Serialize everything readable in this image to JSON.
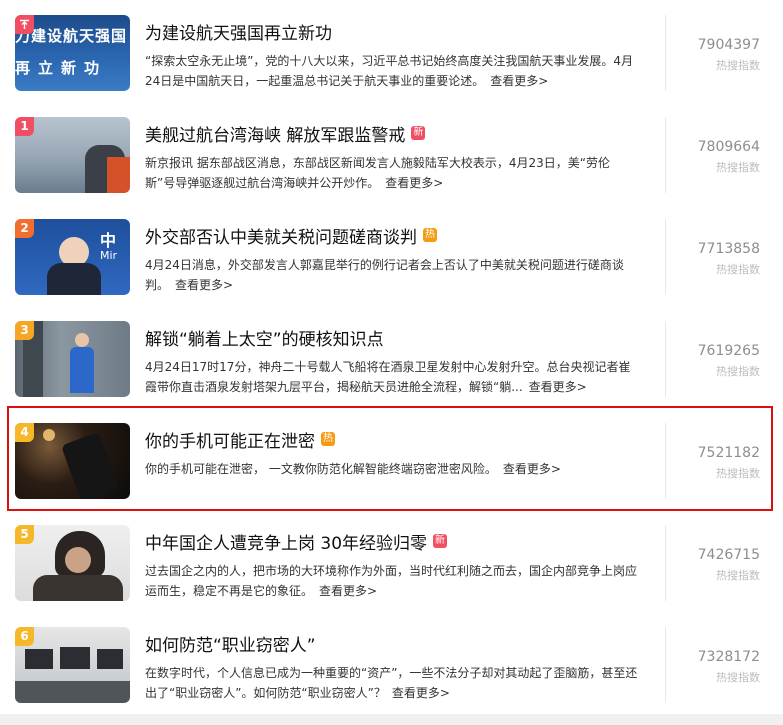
{
  "score_label": "热搜指数",
  "items": [
    {
      "rank": "",
      "rank_color": "#f04e62",
      "title": "为建设航天强国再立新功",
      "badge": "",
      "badge_type": "",
      "summary": "“探索太空永无止境”，党的十八大以来，习近平总书记始终高度关注我国航天事业发展。4月24日是中国航天日，一起重温总书记关于航天事业的重要论述。",
      "more": "查看更多>",
      "score": "7904397",
      "thumb_text": "力建设航天强国 再 立 新 功"
    },
    {
      "rank": "1",
      "rank_color": "#f04e62",
      "title": "美舰过航台湾海峡 解放军跟监警戒",
      "badge": "新",
      "badge_type": "new",
      "summary": "新京报讯 据东部战区消息，东部战区新闻发言人施毅陆军大校表示，4月23日，美“劳伦斯”号导弹驱逐舰过航台湾海峡并公开炒作。",
      "more": "查看更多>",
      "score": "7809664"
    },
    {
      "rank": "2",
      "rank_color": "#f36d2c",
      "title": "外交部否认中美就关税问题磋商谈判",
      "badge": "热",
      "badge_type": "hot",
      "summary": "4月24日消息，外交部发言人郭嘉昆举行的例行记者会上否认了中美就关税问题进行磋商谈判。",
      "more": "查看更多>",
      "score": "7713858",
      "thumb_text": "中 Mir"
    },
    {
      "rank": "3",
      "rank_color": "#f5a623",
      "title": "解锁“躺着上太空”的硬核知识点",
      "badge": "",
      "badge_type": "",
      "summary": "4月24日17时17分，神舟二十号载人飞船将在酒泉卫星发射中心发射升空。总台央视记者崔霞带你直击酒泉发射塔架九层平台，揭秘航天员进舱全流程，解锁“躺...",
      "more": "查看更多>",
      "score": "7619265"
    },
    {
      "rank": "4",
      "rank_color": "#f5b829",
      "title": "你的手机可能正在泄密",
      "badge": "热",
      "badge_type": "hot",
      "summary": "你的手机可能在泄密， 一文教你防范化解智能终端窃密泄密风险。",
      "more": "查看更多>",
      "score": "7521182"
    },
    {
      "rank": "5",
      "rank_color": "#f5b829",
      "title": "中年国企人遭竞争上岗 30年经验归零",
      "badge": "新",
      "badge_type": "new",
      "summary": "过去国企之内的人，把市场的大环境称作为外面，当时代红利随之而去，国企内部竞争上岗应运而生，稳定不再是它的象征。",
      "more": "查看更多>",
      "score": "7426715"
    },
    {
      "rank": "6",
      "rank_color": "#f5b829",
      "title": "如何防范“职业窃密人”",
      "badge": "",
      "badge_type": "",
      "summary": "在数字时代，个人信息已成为一种重要的“资产”，一些不法分子却对其动起了歪脑筋，甚至还出了“职业窃密人”。如何防范“职业窃密人”？",
      "more": "查看更多>",
      "score": "7328172"
    }
  ]
}
